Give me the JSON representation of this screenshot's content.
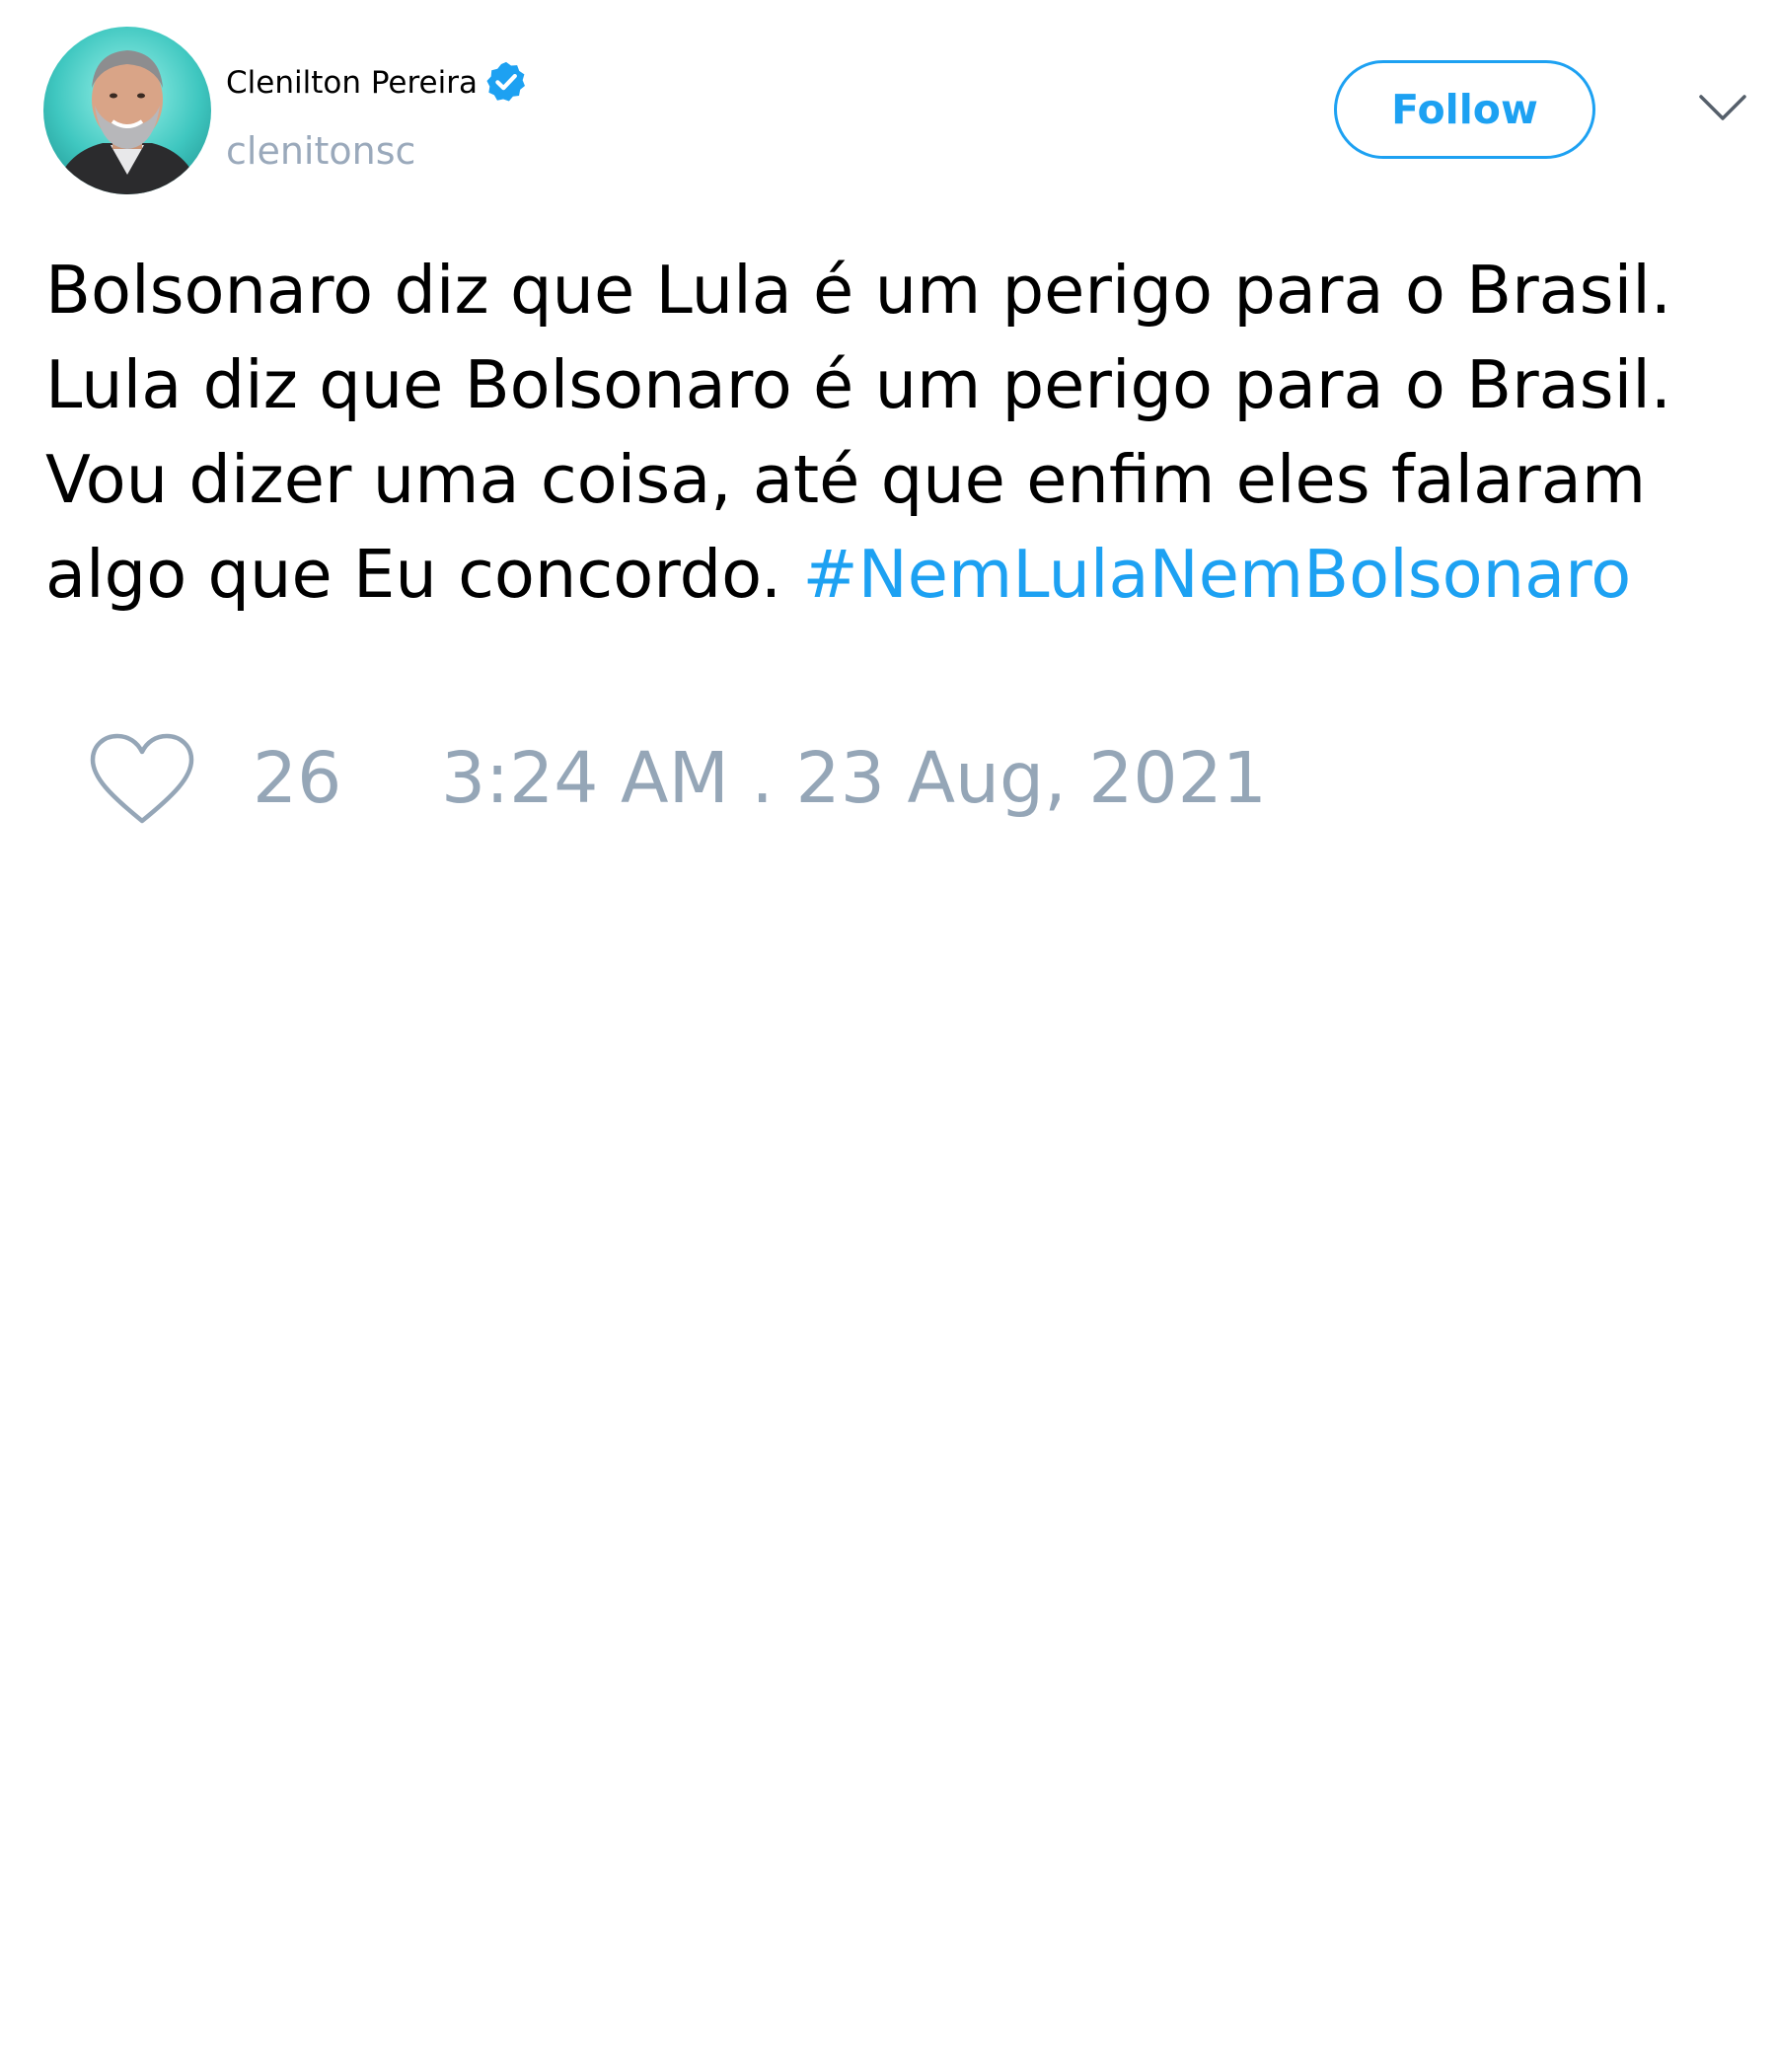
{
  "author": {
    "display_name": "Clenilton Pereira",
    "handle": "clenitonsc",
    "verified": true
  },
  "actions": {
    "follow_label": "Follow",
    "menu_icon": "chevron-down-icon"
  },
  "tweet": {
    "text": "Bolsonaro diz que Lula é um perigo para o Brasil. Lula diz que Bolsonaro é um perigo para o Brasil. Vou dizer uma coisa, até que enfim eles falaram algo que Eu concordo.",
    "hashtag": "#NemLulaNemBolsonaro"
  },
  "footer": {
    "like_icon": "heart-icon",
    "like_count": "26",
    "timestamp": "3:24 AM . 23 Aug, 2021"
  },
  "colors": {
    "accent": "#1da1f2",
    "muted": "#95a6b7",
    "text": "#000000"
  }
}
